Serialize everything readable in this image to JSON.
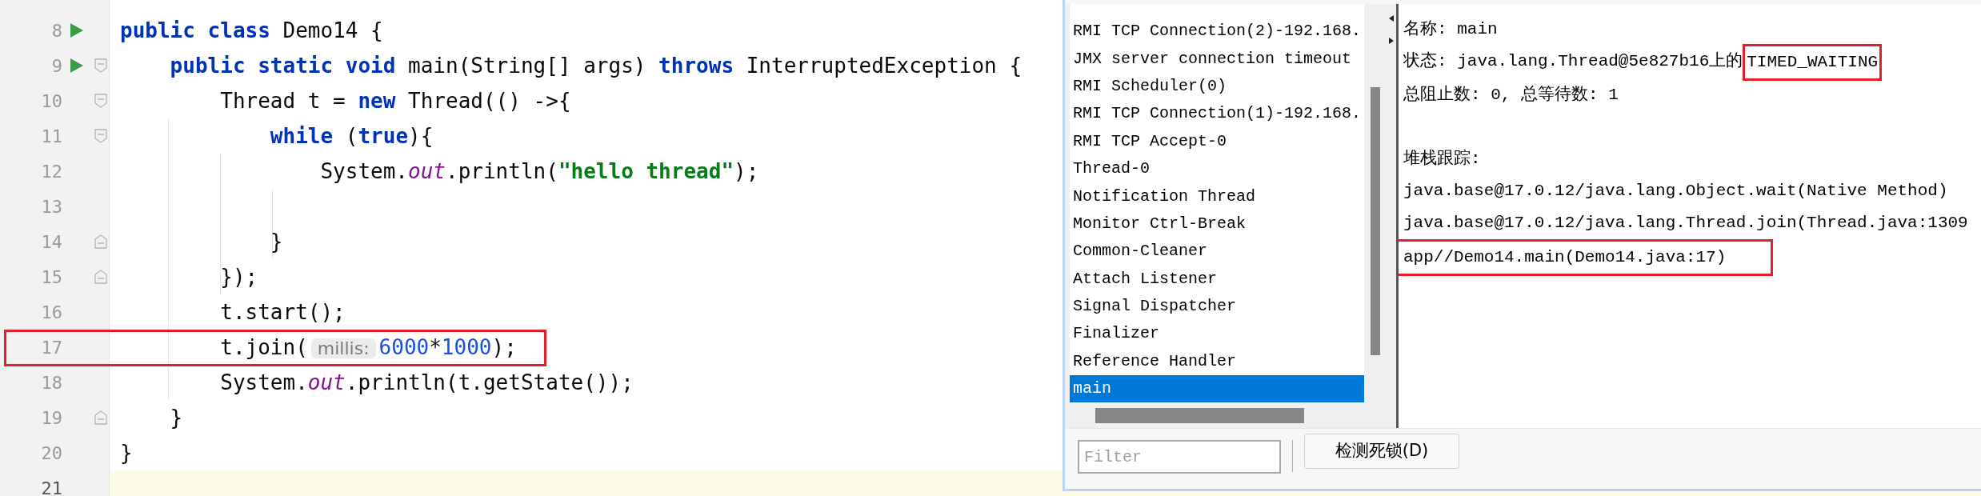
{
  "editor": {
    "lines": [
      {
        "number": "8",
        "run": true,
        "fold_open": false,
        "fold_close": false,
        "annotated": false,
        "current": false,
        "tokens": [
          {
            "kind": "keyword",
            "text": "public class "
          },
          {
            "kind": "plain",
            "text": "Demo14 {"
          }
        ]
      },
      {
        "number": "9",
        "run": true,
        "fold_open": true,
        "fold_close": false,
        "annotated": false,
        "current": false,
        "tokens": [
          {
            "kind": "keyword",
            "text": "    public static void "
          },
          {
            "kind": "plain",
            "text": "main(String[] args) "
          },
          {
            "kind": "keyword",
            "text": "throws "
          },
          {
            "kind": "plain",
            "text": "InterruptedException {"
          }
        ]
      },
      {
        "number": "10",
        "run": false,
        "fold_open": true,
        "fold_close": false,
        "annotated": false,
        "current": false,
        "tokens": [
          {
            "kind": "plain",
            "text": "        Thread t = "
          },
          {
            "kind": "keyword",
            "text": "new "
          },
          {
            "kind": "plain",
            "text": "Thread(() ->{"
          }
        ]
      },
      {
        "number": "11",
        "run": false,
        "fold_open": true,
        "fold_close": false,
        "annotated": false,
        "current": false,
        "tokens": [
          {
            "kind": "keyword",
            "text": "            while "
          },
          {
            "kind": "plain",
            "text": "("
          },
          {
            "kind": "keyword",
            "text": "true"
          },
          {
            "kind": "plain",
            "text": "){"
          }
        ]
      },
      {
        "number": "12",
        "run": false,
        "fold_open": false,
        "fold_close": false,
        "annotated": false,
        "current": false,
        "tokens": [
          {
            "kind": "plain",
            "text": "                System."
          },
          {
            "kind": "field",
            "text": "out"
          },
          {
            "kind": "plain",
            "text": ".println("
          },
          {
            "kind": "string",
            "text": "\"hello thread\""
          },
          {
            "kind": "plain",
            "text": ");"
          }
        ]
      },
      {
        "number": "13",
        "run": false,
        "fold_open": false,
        "fold_close": false,
        "annotated": false,
        "current": false
      },
      {
        "number": "14",
        "run": false,
        "fold_open": false,
        "fold_close": true,
        "annotated": false,
        "current": false,
        "tokens": [
          {
            "kind": "plain",
            "text": "            }"
          }
        ]
      },
      {
        "number": "15",
        "run": false,
        "fold_open": false,
        "fold_close": true,
        "annotated": false,
        "current": false,
        "tokens": [
          {
            "kind": "plain",
            "text": "        });"
          }
        ]
      },
      {
        "number": "16",
        "run": false,
        "fold_open": false,
        "fold_close": false,
        "annotated": false,
        "current": false,
        "tokens": [
          {
            "kind": "plain",
            "text": "        t.start();"
          }
        ]
      },
      {
        "number": "17",
        "run": false,
        "fold_open": false,
        "fold_close": false,
        "annotated": true,
        "current": false,
        "tokens": [
          {
            "kind": "plain",
            "text": "        t.join("
          },
          {
            "kind": "hint",
            "text": "millis:"
          },
          {
            "kind": "number",
            "text": "6000"
          },
          {
            "kind": "plain",
            "text": "*"
          },
          {
            "kind": "number",
            "text": "1000"
          },
          {
            "kind": "plain",
            "text": ");"
          }
        ]
      },
      {
        "number": "18",
        "run": false,
        "fold_open": false,
        "fold_close": false,
        "annotated": false,
        "current": false,
        "tokens": [
          {
            "kind": "plain",
            "text": "        System."
          },
          {
            "kind": "field",
            "text": "out"
          },
          {
            "kind": "plain",
            "text": ".println(t.getState());"
          }
        ]
      },
      {
        "number": "19",
        "run": false,
        "fold_open": false,
        "fold_close": true,
        "annotated": false,
        "current": false,
        "tokens": [
          {
            "kind": "plain",
            "text": "    }"
          }
        ]
      },
      {
        "number": "20",
        "run": false,
        "fold_open": false,
        "fold_close": false,
        "annotated": false,
        "current": false,
        "tokens": [
          {
            "kind": "plain",
            "text": "}"
          }
        ]
      },
      {
        "number": "21",
        "run": false,
        "fold_open": false,
        "fold_close": false,
        "annotated": false,
        "current": true
      }
    ]
  },
  "jconsole": {
    "threads": [
      {
        "name": "RMI TCP Connection(2)-192.168.",
        "selected": false
      },
      {
        "name": "JMX server connection timeout",
        "selected": false
      },
      {
        "name": "RMI Scheduler(0)",
        "selected": false
      },
      {
        "name": "RMI TCP Connection(1)-192.168.",
        "selected": false
      },
      {
        "name": "RMI TCP Accept-0",
        "selected": false
      },
      {
        "name": "Thread-0",
        "selected": false
      },
      {
        "name": "Notification Thread",
        "selected": false
      },
      {
        "name": "Monitor Ctrl-Break",
        "selected": false
      },
      {
        "name": "Common-Cleaner",
        "selected": false
      },
      {
        "name": "Attach Listener",
        "selected": false
      },
      {
        "name": "Signal Dispatcher",
        "selected": false
      },
      {
        "name": "Finalizer",
        "selected": false
      },
      {
        "name": "Reference Handler",
        "selected": false
      },
      {
        "name": "main",
        "selected": true
      }
    ],
    "detail": {
      "name": "名称: main",
      "state": [
        {
          "text": "状态: java.lang.Thread@5e827b16上的",
          "boxed": false
        },
        {
          "text": "TIMED_WAITING",
          "boxed": true
        }
      ],
      "counts": "总阻止数: 0, 总等待数: 1",
      "stack_title": "堆栈跟踪:",
      "stack": [
        {
          "text": "java.base@17.0.12/java.lang.Object.wait(Native Method)",
          "boxed": false
        },
        {
          "text": "java.base@17.0.12/java.lang.Thread.join(Thread.java:1309",
          "boxed": false
        },
        {
          "text": "app//Demo14.main(Demo14.java:17)",
          "boxed": true
        }
      ]
    },
    "filter": {
      "placeholder": "Filter"
    },
    "button": "检测死锁(D)"
  }
}
